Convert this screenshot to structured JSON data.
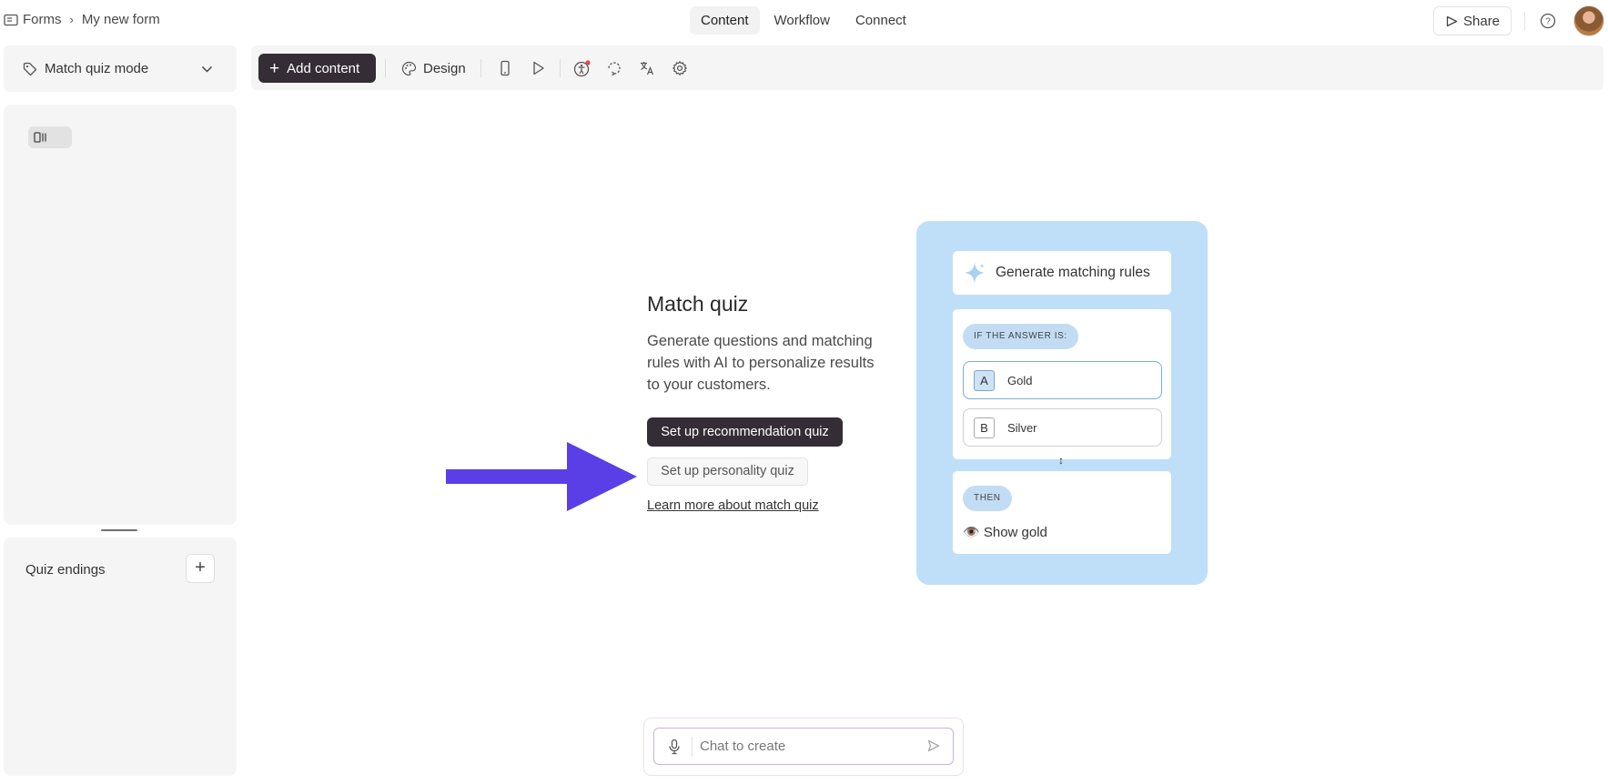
{
  "breadcrumb": {
    "root": "Forms",
    "separator": "›",
    "current": "My new form"
  },
  "nav": {
    "tabs": [
      "Content",
      "Workflow",
      "Connect"
    ],
    "active": "Content"
  },
  "header": {
    "share_label": "Share"
  },
  "sidebar": {
    "mode_select": "Match quiz mode",
    "endings_label": "Quiz endings",
    "endings_add": "+"
  },
  "toolbar": {
    "add_content_label": "Add content",
    "add_content_plus": "+",
    "design_label": "Design"
  },
  "main": {
    "title": "Match quiz",
    "description": "Generate questions and matching rules with AI to personalize results to your customers.",
    "primary_button": "Set up recommendation quiz",
    "secondary_button": "Set up personality quiz",
    "learn_more": "Learn more about match quiz"
  },
  "illustration": {
    "generate_label": "Generate matching rules",
    "if_label": "IF THE ANSWER IS:",
    "options": [
      {
        "key": "A",
        "label": "Gold",
        "selected": true
      },
      {
        "key": "B",
        "label": "Silver",
        "selected": false
      }
    ],
    "connector": "↕",
    "then_label": "THEN",
    "result": "👁️ Show gold"
  },
  "chat": {
    "placeholder": "Chat to create"
  },
  "colors": {
    "accent_dark": "#352d36",
    "arrow": "#5a3fe6",
    "illustration_bg": "#bfdff8",
    "notification_dot": "#e5484d"
  }
}
